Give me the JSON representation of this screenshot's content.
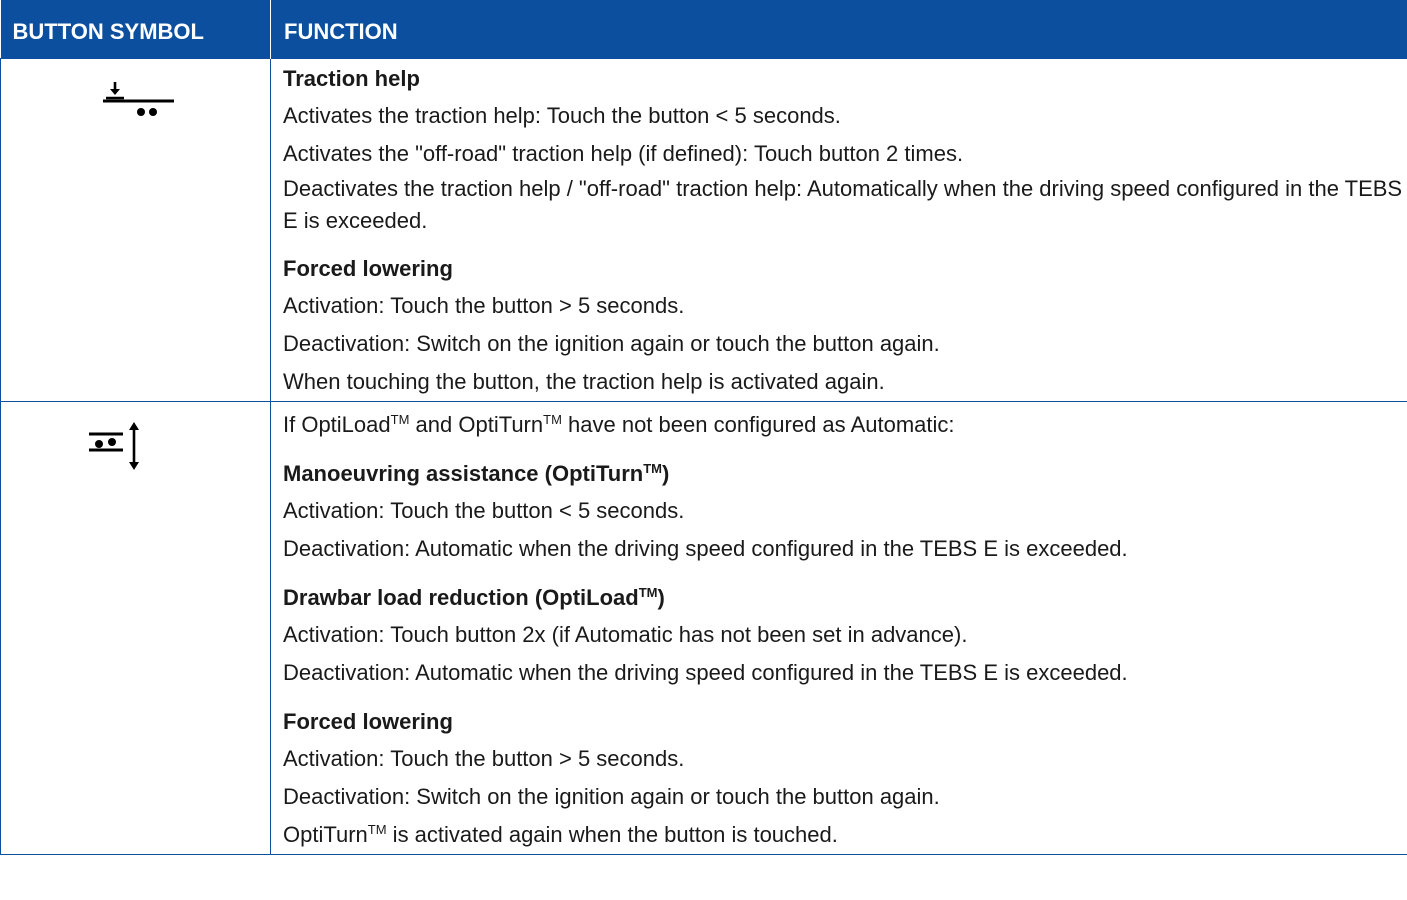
{
  "table": {
    "headers": {
      "symbol": "BUTTON SYMBOL",
      "function": "FUNCTION"
    },
    "rows": [
      {
        "icon": "traction-help-icon",
        "sections": [
          {
            "title": "Traction help",
            "lines": [
              "Activates the traction help: Touch the button < 5 seconds.",
              "Activates the \"off-road\" traction help (if defined): Touch button 2 times.",
              "Deactivates the traction help / \"off-road\" traction help: Automatically when the driving speed configured in the TEBS E is exceeded."
            ]
          },
          {
            "title": "Forced lowering",
            "lines": [
              "Activation: Touch the button > 5 seconds.",
              "Deactivation: Switch on the ignition again or touch the button again.",
              "When touching the button, the traction help is activated again."
            ]
          }
        ]
      },
      {
        "icon": "optiturn-optiload-icon",
        "intro": {
          "before": "If OptiLoad",
          "tm1": "TM",
          "middle": " and OptiTurn",
          "tm2": "TM",
          "after": " have not been configured as Automatic:"
        },
        "sections": [
          {
            "title": "Manoeuvring assistance (OptiTurn",
            "title_tm": "TM",
            "title_end": ")",
            "lines": [
              "Activation: Touch the button < 5 seconds.",
              "Deactivation: Automatic when the driving speed configured in the TEBS E is exceeded."
            ]
          },
          {
            "title": "Drawbar load reduction (OptiLoad",
            "title_tm": "TM",
            "title_end": ")",
            "lines": [
              "Activation: Touch button 2x (if Automatic has not been set in advance).",
              "Deactivation: Automatic when the driving speed configured in the TEBS E is exceeded."
            ]
          },
          {
            "title": "Forced lowering",
            "lines": [
              "Activation: Touch the button > 5 seconds.",
              "Deactivation: Switch on the ignition again or touch the button again."
            ],
            "last_line": {
              "before": "OptiTurn",
              "tm": "TM",
              "after": " is activated again when the button is touched."
            }
          }
        ]
      }
    ]
  }
}
